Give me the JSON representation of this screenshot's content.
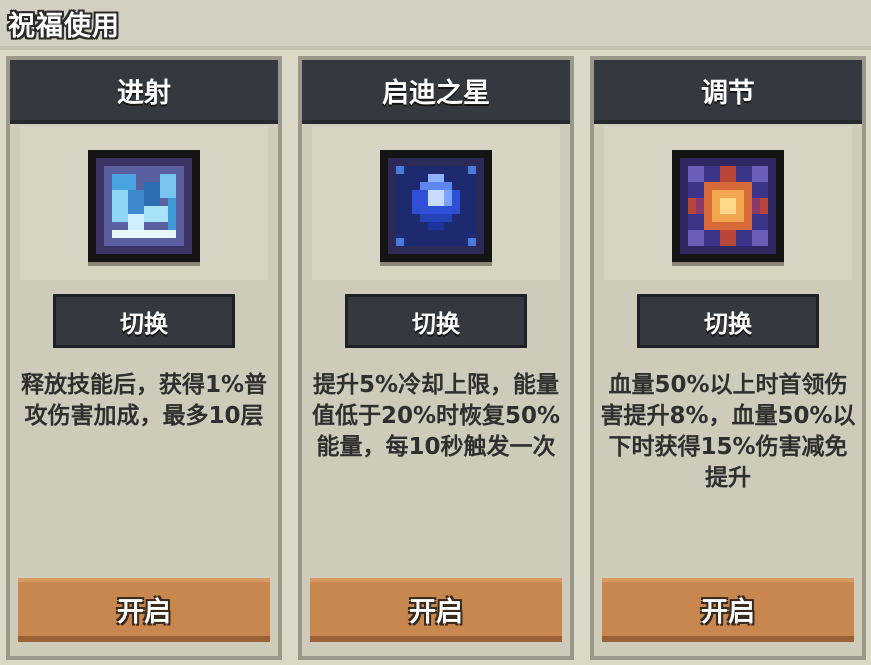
{
  "page": {
    "title": "祝福使用"
  },
  "cards": [
    {
      "name": "进射",
      "icon": "ice-shard-icon",
      "switch_label": "切换",
      "description": "释放技能后，获得1%普攻伤害加成，最多10层",
      "enable_label": "开启"
    },
    {
      "name": "启迪之星",
      "icon": "blue-crystal-star-icon",
      "switch_label": "切换",
      "description": "提升5%冷却上限，能量值低于20%时恢复50%能量，每10秒触发一次",
      "enable_label": "开启"
    },
    {
      "name": "调节",
      "icon": "orange-starburst-icon",
      "switch_label": "切换",
      "description": "血量50%以上时首领伤害提升8%，血量50%以下时获得15%伤害减免提升",
      "enable_label": "开启"
    }
  ],
  "colors": {
    "header_dark": "#33393f",
    "enable_orange": "#c8874f",
    "panel_bg": "#cfcbba"
  }
}
